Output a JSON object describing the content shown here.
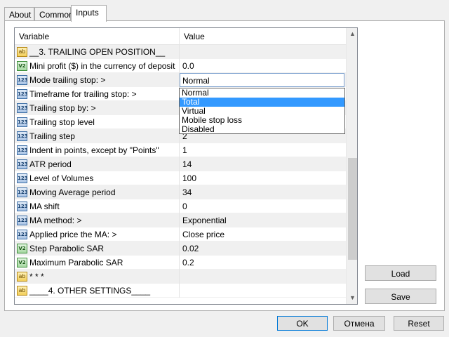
{
  "tabs": [
    "About",
    "Common",
    "Inputs"
  ],
  "grid": {
    "headers": {
      "variable": "Variable",
      "value": "Value"
    },
    "rows": [
      {
        "icon": "ab",
        "label": "__3. TRAILING OPEN POSITION__",
        "value": ""
      },
      {
        "icon": "v2",
        "label": "Mini profit ($) in the currency of deposit",
        "value": "0.0"
      },
      {
        "icon": "123",
        "label": "Mode trailing stop: >",
        "value": "Normal"
      },
      {
        "icon": "123",
        "label": "Timeframe for trailing stop: >",
        "value": ""
      },
      {
        "icon": "123",
        "label": "Trailing stop by: >",
        "value": ""
      },
      {
        "icon": "123",
        "label": "Trailing stop level",
        "value": ""
      },
      {
        "icon": "123",
        "label": "Trailing step",
        "value": "2"
      },
      {
        "icon": "123",
        "label": "Indent in points, except by \"Points\"",
        "value": "1"
      },
      {
        "icon": "123",
        "label": "ATR period",
        "value": "14"
      },
      {
        "icon": "123",
        "label": "Level of Volumes",
        "value": "100"
      },
      {
        "icon": "123",
        "label": "Moving Average period",
        "value": "34"
      },
      {
        "icon": "123",
        "label": "MA shift",
        "value": "0"
      },
      {
        "icon": "123",
        "label": "MA method: >",
        "value": "Exponential"
      },
      {
        "icon": "123",
        "label": "Applied price the MA: >",
        "value": "Close price"
      },
      {
        "icon": "v2",
        "label": "Step Parabolic SAR",
        "value": "0.02"
      },
      {
        "icon": "v2",
        "label": "Maximum Parabolic SAR",
        "value": "0.2"
      },
      {
        "icon": "ab",
        "label": "* * *",
        "value": ""
      },
      {
        "icon": "ab",
        "label": "____4. OTHER SETTINGS____",
        "value": ""
      }
    ],
    "dropdown_options": [
      "Normal",
      "Total",
      "Virtual",
      "Mobile stop loss",
      "Disabled"
    ],
    "dropdown_highlighted": "Total"
  },
  "side_buttons": {
    "load": "Load",
    "save": "Save"
  },
  "footer_buttons": {
    "ok": "OK",
    "cancel": "Отмена",
    "reset": "Reset"
  },
  "icons": {
    "ab": "ab",
    "v2": "V2",
    "123": "123"
  }
}
